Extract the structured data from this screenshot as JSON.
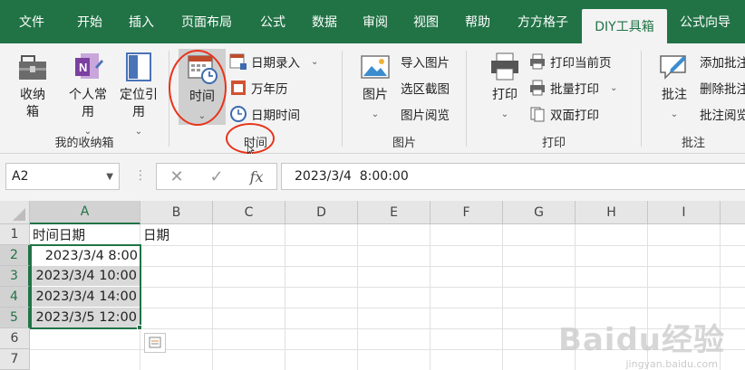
{
  "tabs": [
    {
      "label": "文件",
      "active": false
    },
    {
      "label": "开始",
      "active": false
    },
    {
      "label": "插入",
      "active": false
    },
    {
      "label": "页面布局",
      "active": false
    },
    {
      "label": "公式",
      "active": false
    },
    {
      "label": "数据",
      "active": false
    },
    {
      "label": "审阅",
      "active": false
    },
    {
      "label": "视图",
      "active": false
    },
    {
      "label": "帮助",
      "active": false
    },
    {
      "label": "方方格子",
      "active": false
    },
    {
      "label": "DIY工具箱",
      "active": true
    },
    {
      "label": "公式向导",
      "active": false
    }
  ],
  "ribbon": {
    "group1": {
      "label": "我的收纳箱",
      "btn_storage": "收纳箱",
      "btn_personal": "个人常用",
      "btn_locate": "定位引用"
    },
    "group2": {
      "label": "时间",
      "btn_time": "时间",
      "btn_date_entry": "日期录入",
      "btn_calendar": "万年历",
      "btn_datetime": "日期时间"
    },
    "group3": {
      "label": "图片",
      "btn_picture": "图片",
      "btn_import": "导入图片",
      "btn_screenshot": "选区截图",
      "btn_browse": "图片阅览"
    },
    "group4": {
      "label": "打印",
      "btn_print": "打印",
      "btn_print_current": "打印当前页",
      "btn_batch_print": "批量打印",
      "btn_duplex": "双面打印"
    },
    "group5": {
      "label": "批注",
      "btn_comment": "批注",
      "btn_add": "添加批注",
      "btn_delete": "删除批注",
      "btn_view": "批注阅览"
    }
  },
  "formula_bar": {
    "name_box": "A2",
    "content": "2023/3/4  8:00:00"
  },
  "columns": [
    "A",
    "B",
    "C",
    "D",
    "E",
    "F",
    "G",
    "H",
    "I"
  ],
  "rows": [
    "1",
    "2",
    "3",
    "4",
    "5",
    "6",
    "7"
  ],
  "cells": {
    "A1": "时间日期",
    "B1": "日期",
    "A2": "2023/3/4 8:00",
    "A3": "2023/3/4 10:00",
    "A4": "2023/3/4 14:00",
    "A5": "2023/3/5 12:00"
  },
  "watermark": {
    "main": "Baidu经验",
    "sub": "jingyan.baidu.com"
  },
  "colors": {
    "accent": "#217346",
    "highlight": "#e8341c"
  }
}
